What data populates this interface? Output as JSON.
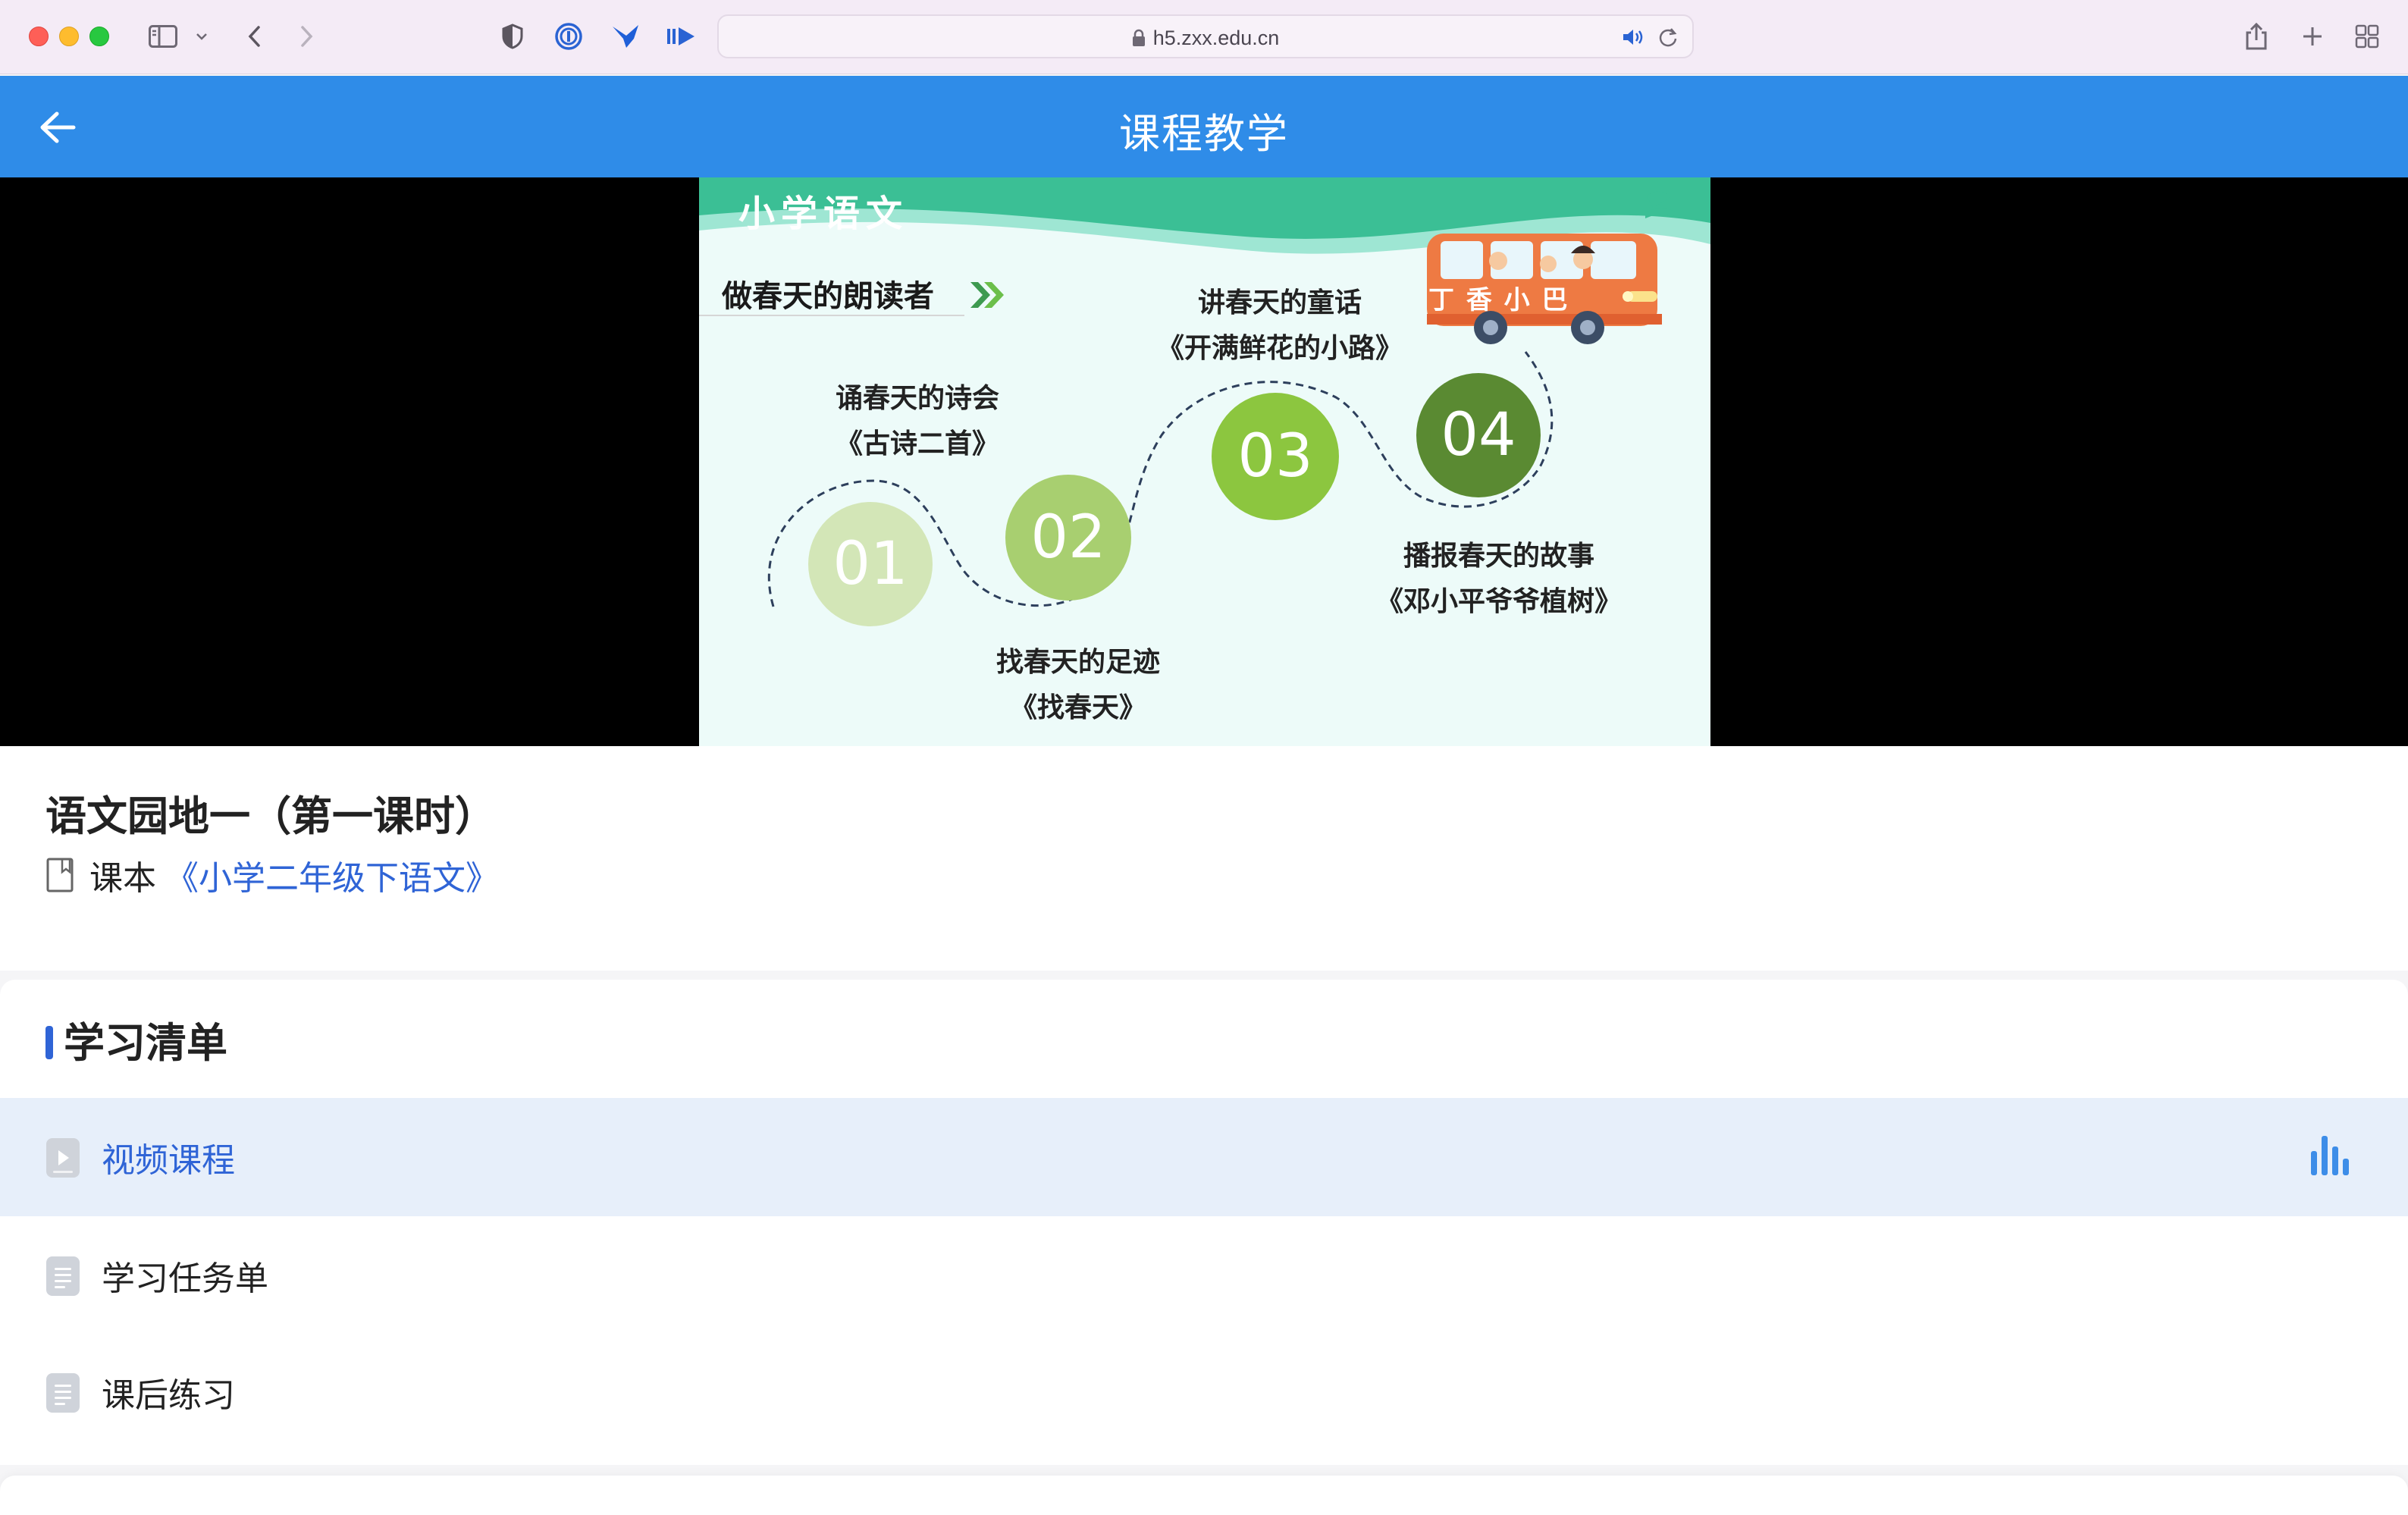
{
  "browser": {
    "url": "h5.zxx.edu.cn"
  },
  "header": {
    "title": "课程教学"
  },
  "slide": {
    "brand": "小学语文",
    "heading": "做春天的朗读者",
    "bus_text": "丁 香 小 巴",
    "items": [
      {
        "num": "01",
        "line1": "诵春天的诗会",
        "line2": "《古诗二首》"
      },
      {
        "num": "02",
        "line1": "找春天的足迹",
        "line2": "《找春天》"
      },
      {
        "num": "03",
        "line1": "讲春天的童话",
        "line2": "《开满鲜花的小路》"
      },
      {
        "num": "04",
        "line1": "播报春天的故事",
        "line2": "《邓小平爷爷植树》"
      }
    ]
  },
  "course": {
    "title": "语文园地一（第一课时）",
    "book_label": "课本",
    "book_name": "《小学二年级下语文》"
  },
  "study_list": {
    "title": "学习清单",
    "items": [
      {
        "label": "视频课程",
        "active": true
      },
      {
        "label": "学习任务单",
        "active": false
      },
      {
        "label": "课后练习",
        "active": false
      }
    ]
  },
  "colors": {
    "header_blue": "#2f8ce8",
    "link_blue": "#2f64d6",
    "active_row": "#e7effa",
    "slide_green_band": "#3bbf95"
  },
  "icons": {
    "back": "arrow-left-icon",
    "playing": "audio-bars-icon",
    "book": "book-outline-icon"
  }
}
